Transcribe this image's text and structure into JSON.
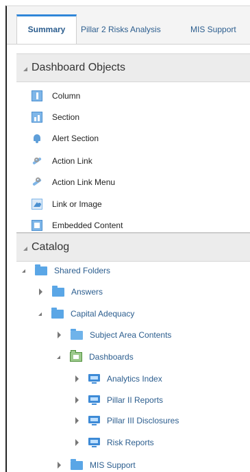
{
  "tabs": [
    {
      "label": "Summary",
      "active": true
    },
    {
      "label": "Pillar 2 Risks Analysis",
      "active": false
    },
    {
      "label": "MIS Support",
      "active": false
    }
  ],
  "dashboard_objects": {
    "title": "Dashboard Objects",
    "items": [
      {
        "label": "Column",
        "icon": "column-icon"
      },
      {
        "label": "Section",
        "icon": "section-icon"
      },
      {
        "label": "Alert Section",
        "icon": "alert-section-icon"
      },
      {
        "label": "Action Link",
        "icon": "action-link-icon"
      },
      {
        "label": "Action Link Menu",
        "icon": "action-link-menu-icon"
      },
      {
        "label": "Link or Image",
        "icon": "link-or-image-icon"
      },
      {
        "label": "Embedded Content",
        "icon": "embedded-content-icon"
      }
    ]
  },
  "catalog": {
    "title": "Catalog",
    "tree": [
      {
        "label": "Shared Folders",
        "level": 0,
        "state": "expanded",
        "icon": "folder-icon"
      },
      {
        "label": "Answers",
        "level": 1,
        "state": "collapsed",
        "icon": "folder-icon"
      },
      {
        "label": "Capital Adequacy",
        "level": 1,
        "state": "expanded",
        "icon": "folder-icon"
      },
      {
        "label": "Subject Area Contents",
        "level": 2,
        "state": "collapsed",
        "icon": "folder-icon"
      },
      {
        "label": "Dashboards",
        "level": 2,
        "state": "expanded",
        "icon": "dashboard-folder-icon"
      },
      {
        "label": "Analytics Index",
        "level": 3,
        "state": "collapsed",
        "icon": "dashboard-icon"
      },
      {
        "label": "Pillar II Reports",
        "level": 3,
        "state": "collapsed",
        "icon": "dashboard-icon"
      },
      {
        "label": "Pillar III Disclosures",
        "level": 3,
        "state": "collapsed",
        "icon": "dashboard-icon"
      },
      {
        "label": "Risk Reports",
        "level": 3,
        "state": "collapsed",
        "icon": "dashboard-icon"
      },
      {
        "label": "MIS Support",
        "level": 1,
        "state": "collapsed",
        "icon": "folder-icon"
      }
    ]
  },
  "colors": {
    "link": "#2b5d8e",
    "tab_accent": "#2f86d8",
    "folder": "#5aa6e6"
  }
}
